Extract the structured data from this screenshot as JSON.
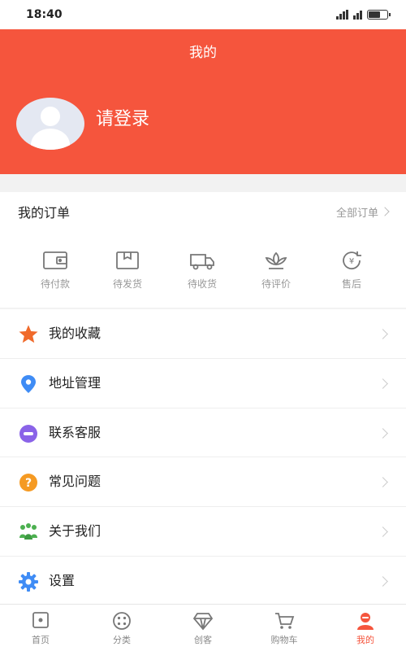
{
  "status_bar": {
    "time": "18:40"
  },
  "header": {
    "title": "我的",
    "login_text": "请登录",
    "background_color": "#f5553d"
  },
  "orders": {
    "title": "我的订单",
    "all_orders": "全部订单",
    "items": [
      {
        "label": "待付款",
        "icon": "wallet-icon"
      },
      {
        "label": "待发货",
        "icon": "package-icon"
      },
      {
        "label": "待收货",
        "icon": "truck-icon"
      },
      {
        "label": "待评价",
        "icon": "lotus-icon"
      },
      {
        "label": "售后",
        "icon": "refund-icon"
      }
    ]
  },
  "menu": {
    "items": [
      {
        "label": "我的收藏",
        "icon": "star-icon",
        "color": "#f06a2b"
      },
      {
        "label": "地址管理",
        "icon": "location-pin-icon",
        "color": "#3f8cf5"
      },
      {
        "label": "联系客服",
        "icon": "chat-icon",
        "color": "#8a63e8"
      },
      {
        "label": "常见问题",
        "icon": "question-icon",
        "color": "#f59a23"
      },
      {
        "label": "关于我们",
        "icon": "people-icon",
        "color": "#4cb050"
      },
      {
        "label": "设置",
        "icon": "gear-icon",
        "color": "#3f8cf5"
      }
    ]
  },
  "tabbar": {
    "items": [
      {
        "label": "首页",
        "icon": "home-icon",
        "active": false
      },
      {
        "label": "分类",
        "icon": "category-icon",
        "active": false
      },
      {
        "label": "创客",
        "icon": "diamond-icon",
        "active": false
      },
      {
        "label": "购物车",
        "icon": "cart-icon",
        "active": false
      },
      {
        "label": "我的",
        "icon": "profile-icon",
        "active": true
      }
    ]
  }
}
